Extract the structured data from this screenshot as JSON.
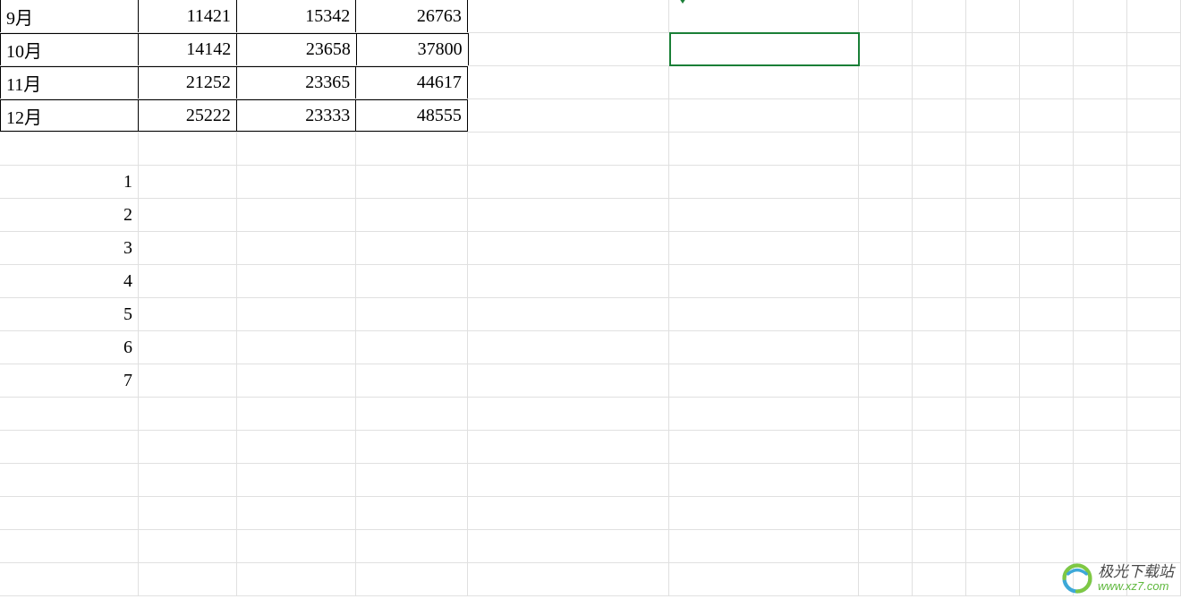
{
  "data_rows": [
    {
      "month": "9月",
      "val1": "11421",
      "val2": "15342",
      "val3": "26763"
    },
    {
      "month": "10月",
      "val1": "14142",
      "val2": "23658",
      "val3": "37800"
    },
    {
      "month": "11月",
      "val1": "21252",
      "val2": "23365",
      "val3": "44617"
    },
    {
      "month": "12月",
      "val1": "25222",
      "val2": "23333",
      "val3": "48555"
    }
  ],
  "number_list": [
    "1",
    "2",
    "3",
    "4",
    "5",
    "6",
    "7"
  ],
  "watermark": {
    "title": "极光下载站",
    "url": "www.xz7.com"
  }
}
